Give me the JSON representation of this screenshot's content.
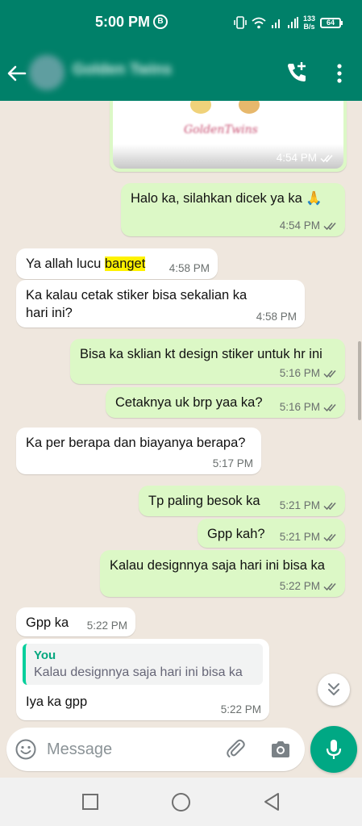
{
  "status_bar": {
    "time": "5:00 PM",
    "b_badge": "B",
    "net_speed_value": "133",
    "net_speed_unit": "B/s",
    "battery": "64"
  },
  "header": {
    "contact_name": "Golden Twins"
  },
  "image_message": {
    "caption_logo": "GoldenTwins",
    "time": "4:54 PM",
    "status": "read"
  },
  "messages": [
    {
      "direction": "out",
      "text": "Halo ka, silahkan dicek ya ka 🙏",
      "time": "4:54 PM",
      "status": "read"
    },
    {
      "direction": "in",
      "text_before": "Ya allah lucu ",
      "highlight": "banget",
      "time": "4:58 PM"
    },
    {
      "direction": "in",
      "text": "Ka kalau cetak stiker bisa sekalian ka hari ini?",
      "time": "4:58 PM"
    },
    {
      "direction": "out",
      "text": "Bisa ka sklian kt design stiker untuk hr ini",
      "time": "5:16 PM",
      "status": "read"
    },
    {
      "direction": "out",
      "text": "Cetaknya uk brp yaa ka?",
      "time": "5:16 PM",
      "status": "read"
    },
    {
      "direction": "in",
      "text": "Ka per berapa dan biayanya berapa?",
      "time": "5:17 PM"
    },
    {
      "direction": "out",
      "text": "Tp paling besok ka",
      "time": "5:21 PM",
      "status": "read"
    },
    {
      "direction": "out",
      "text": "Gpp kah?",
      "time": "5:21 PM",
      "status": "read"
    },
    {
      "direction": "out",
      "text": "Kalau designnya saja hari ini bisa ka",
      "time": "5:22 PM",
      "status": "read"
    },
    {
      "direction": "in",
      "text": "Gpp ka",
      "time": "5:22 PM"
    },
    {
      "direction": "in",
      "quote_author": "You",
      "quote_text": "Kalau designnya saja hari ini bisa ka",
      "text": "Iya ka gpp",
      "time": "5:22 PM"
    }
  ],
  "composer": {
    "placeholder": "Message"
  },
  "colors": {
    "brand": "#008069",
    "outgoing_bubble": "#dcf8c6",
    "incoming_bubble": "#ffffff",
    "chat_background": "#efe7de",
    "mic_button": "#00a884",
    "quote_bar": "#06cf9c",
    "highlight": "#fff200"
  },
  "icons": {
    "back": "arrow-left-icon",
    "call": "add-call-icon",
    "menu": "more-vertical-icon",
    "emoji": "emoji-icon",
    "attach": "paperclip-icon",
    "camera": "camera-icon",
    "mic": "mic-icon",
    "scroll": "double-chevron-down-icon",
    "read_receipt": "double-check-icon"
  }
}
